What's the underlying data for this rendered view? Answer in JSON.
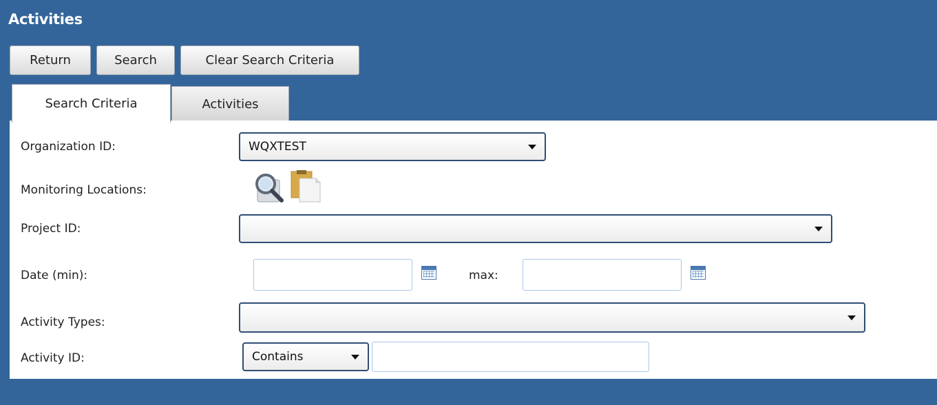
{
  "header": {
    "title": "Activities"
  },
  "toolbar": {
    "return_label": "Return",
    "search_label": "Search",
    "clear_label": "Clear Search Criteria"
  },
  "tabs": [
    {
      "label": "Search Criteria",
      "active": true
    },
    {
      "label": "Activities",
      "active": false
    }
  ],
  "form": {
    "organization_id": {
      "label": "Organization ID:",
      "value": "WQXTEST"
    },
    "monitoring_locations": {
      "label": "Monitoring Locations:",
      "icons": [
        "search-icon",
        "clipboard-icon"
      ]
    },
    "project_id": {
      "label": "Project ID:",
      "value": ""
    },
    "date": {
      "label": "Date (min):",
      "min_value": "",
      "max_label": "max:",
      "max_value": ""
    },
    "activity_types": {
      "label": "Activity Types:",
      "value": ""
    },
    "activity_id": {
      "label": "Activity ID:",
      "operator": "Contains",
      "value": ""
    }
  },
  "colors": {
    "header_bg": "#34659a",
    "select_border": "#2f4d74",
    "textbox_border": "#a9c6e8"
  }
}
